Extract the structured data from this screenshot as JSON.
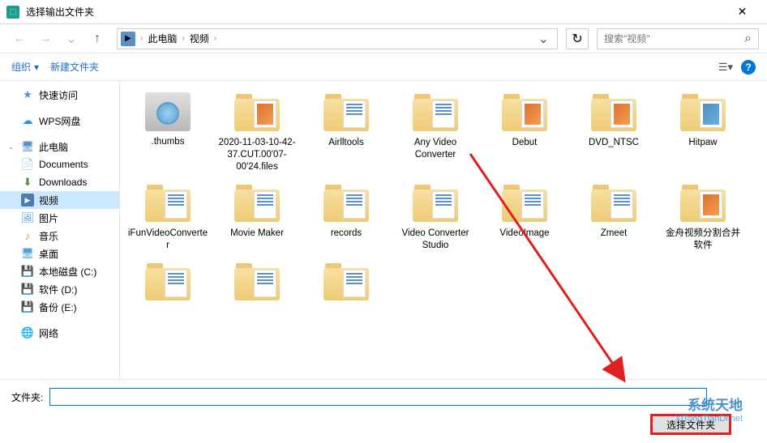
{
  "window": {
    "title": "选择输出文件夹",
    "close": "✕"
  },
  "navbar": {
    "back": "←",
    "forward": "→",
    "up": "↑",
    "path_icon": "▶",
    "path": [
      "此电脑",
      "视频"
    ],
    "sep": "›",
    "dropdown": "⌄",
    "refresh": "↻",
    "search_placeholder": "搜索\"视频\"",
    "search_icon": "🔍"
  },
  "toolbar": {
    "organize": "组织",
    "organize_chev": "▾",
    "new_folder": "新建文件夹",
    "view_icon": "☰▾",
    "help": "?"
  },
  "sidebar": {
    "items": [
      {
        "label": "快速访问",
        "icon": "★",
        "iconClass": "star-icon",
        "chev": ""
      },
      {
        "label": "WPS网盘",
        "icon": "☁",
        "iconClass": "wps-icon",
        "chev": ""
      },
      {
        "label": "此电脑",
        "icon": "🖥",
        "iconClass": "pc-icon",
        "chev": "⌄"
      },
      {
        "label": "Documents",
        "icon": "📄",
        "iconClass": "doc-icon",
        "child": true
      },
      {
        "label": "Downloads",
        "icon": "⬇",
        "iconClass": "dl-icon",
        "child": true
      },
      {
        "label": "视频",
        "icon": "▶",
        "iconClass": "vid-icon",
        "child": true,
        "selected": true
      },
      {
        "label": "图片",
        "icon": "🖼",
        "iconClass": "img-icon",
        "child": true
      },
      {
        "label": "音乐",
        "icon": "♪",
        "iconClass": "music-icon",
        "child": true
      },
      {
        "label": "桌面",
        "icon": "🖥",
        "iconClass": "desktop-icon",
        "child": true
      },
      {
        "label": "本地磁盘 (C:)",
        "icon": "💾",
        "iconClass": "disk-icon",
        "child": true
      },
      {
        "label": "软件 (D:)",
        "icon": "💾",
        "iconClass": "disk-icon",
        "child": true
      },
      {
        "label": "备份 (E:)",
        "icon": "💾",
        "iconClass": "disk-icon",
        "child": true
      },
      {
        "label": "网络",
        "icon": "🌐",
        "iconClass": "net-icon",
        "chev": ""
      }
    ]
  },
  "folders": [
    {
      "label": ".thumbs",
      "type": "thumbs"
    },
    {
      "label": "2020-11-03-10-42-37.CUT.00'07-00'24.files",
      "type": "folder",
      "preview": "orange"
    },
    {
      "label": "Airlltools",
      "type": "folder"
    },
    {
      "label": "Any Video Converter",
      "type": "folder"
    },
    {
      "label": "Debut",
      "type": "folder",
      "preview": "mixed"
    },
    {
      "label": "DVD_NTSC",
      "type": "folder",
      "preview": "mixed"
    },
    {
      "label": "Hitpaw",
      "type": "folder",
      "preview": "blue"
    },
    {
      "label": "iFunVideoConverter",
      "type": "folder"
    },
    {
      "label": "Movie Maker",
      "type": "folder"
    },
    {
      "label": "records",
      "type": "folder"
    },
    {
      "label": "Video Converter Studio",
      "type": "folder"
    },
    {
      "label": "VideoImage",
      "type": "folder"
    },
    {
      "label": "Zmeet",
      "type": "folder"
    },
    {
      "label": "金舟视频分割合并软件",
      "type": "folder",
      "preview": "orange"
    },
    {
      "label": "",
      "type": "folder"
    },
    {
      "label": "",
      "type": "folder"
    },
    {
      "label": "",
      "type": "folder"
    }
  ],
  "footer": {
    "folder_label": "文件夹:",
    "folder_value": "",
    "select_btn": "选择文件夹"
  },
  "watermark": {
    "big": "系统天地",
    "url": "XiTongTianDi.net"
  }
}
